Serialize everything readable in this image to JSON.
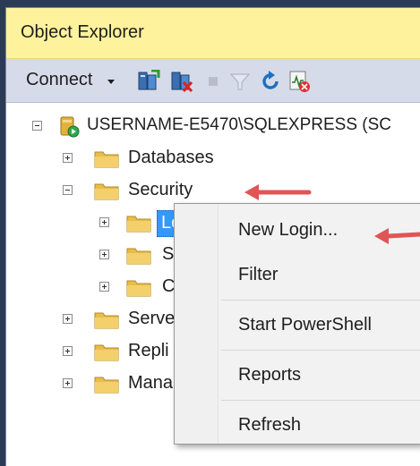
{
  "panel": {
    "title": "Object Explorer"
  },
  "toolbar": {
    "connect_label": "Connect",
    "icons": [
      "connect-server-icon",
      "disconnect-server-icon",
      "stop-icon",
      "filter-icon",
      "refresh-icon",
      "activity-monitor-icon"
    ]
  },
  "tree": {
    "server": "USERNAME-E5470\\SQLEXPRESS (SC",
    "databases": "Databases",
    "security": "Security",
    "logins": "Logins",
    "security_child_2": "S",
    "security_child_3": "C",
    "server_objects": "Serve",
    "replication": "Repli",
    "management": "Mana"
  },
  "context_menu": {
    "items": [
      "New Login...",
      "Filter",
      "Start PowerShell",
      "Reports",
      "Refresh"
    ]
  },
  "colors": {
    "title_bar": "#fff29d",
    "toolbar": "#d6dbe9",
    "selection": "#3399ff",
    "annotation_arrow": "#e05555"
  }
}
